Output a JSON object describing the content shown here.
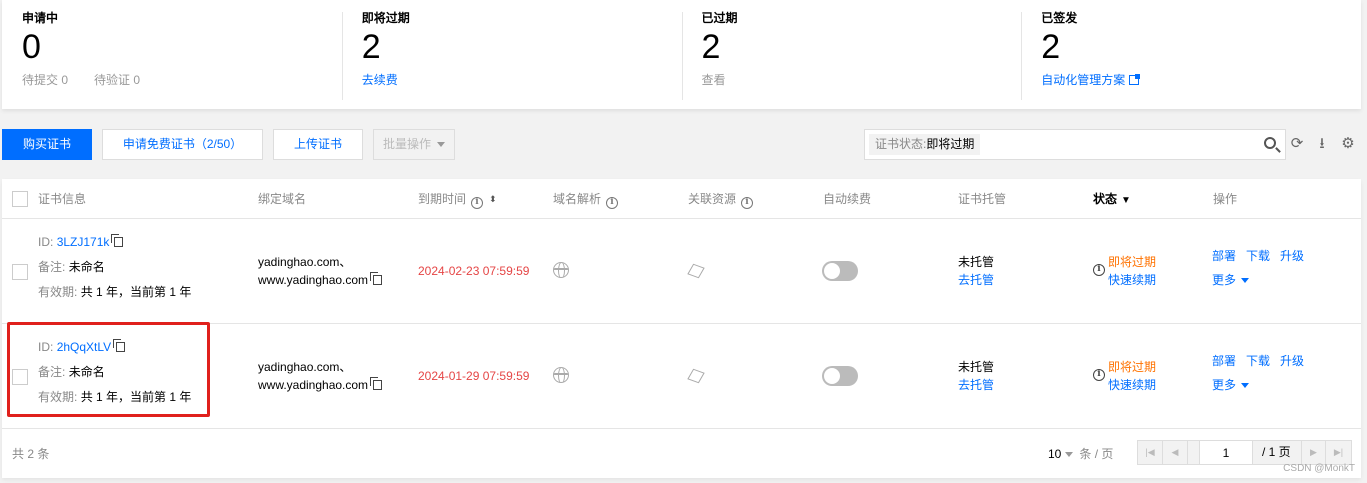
{
  "stats": [
    {
      "title": "申请中",
      "value": "0",
      "subs": [
        "待提交 0",
        "待验证 0"
      ]
    },
    {
      "title": "即将过期",
      "value": "2",
      "link": "去续费"
    },
    {
      "title": "已过期",
      "value": "2",
      "link": "查看"
    },
    {
      "title": "已签发",
      "value": "2",
      "link": "自动化管理方案"
    }
  ],
  "toolbar": {
    "buy": "购买证书",
    "apply_free": "申请免费证书（2/50）",
    "upload": "上传证书",
    "batch": "批量操作",
    "search_tag_key": "证书状态:",
    "search_tag_value": "即将过期"
  },
  "table": {
    "headers": {
      "cert_info": "证书信息",
      "domain": "绑定域名",
      "expire": "到期时间",
      "dns": "域名解析",
      "resources": "关联资源",
      "auto_renew": "自动续费",
      "hosting": "证书托管",
      "status": "状态",
      "actions": "操作"
    },
    "labels": {
      "id": "ID:",
      "note": "备注:",
      "validity": "有效期:"
    },
    "rows": [
      {
        "id": "3LZJ171k",
        "note": "未命名",
        "validity": "共 1 年，当前第 1 年",
        "domain1": "yadinghao.com、",
        "domain2": "www.yadinghao.com",
        "expire": "2024-02-23 07:59:59",
        "hosting": "未托管",
        "hosting_link": "去托管",
        "status": "即将过期",
        "status_link": "快速续期",
        "act_deploy": "部署",
        "act_download": "下载",
        "act_upgrade": "升级",
        "act_more": "更多"
      },
      {
        "id": "2hQqXtLV",
        "note": "未命名",
        "validity": "共 1 年，当前第 1 年",
        "domain1": "yadinghao.com、",
        "domain2": "www.yadinghao.com",
        "expire": "2024-01-29 07:59:59",
        "hosting": "未托管",
        "hosting_link": "去托管",
        "status": "即将过期",
        "status_link": "快速续期",
        "act_deploy": "部署",
        "act_download": "下载",
        "act_upgrade": "升级",
        "act_more": "更多"
      }
    ],
    "footer": {
      "total": "共 2 条",
      "page_size": "10",
      "page_size_unit": "条 / 页",
      "page": "1",
      "page_total": "/ 1 页"
    }
  },
  "watermark": "CSDN @MonkT",
  "colors": {
    "accent": "#006eff",
    "danger": "#e54545",
    "warning": "#ff7200",
    "highlight": "#e0201c"
  }
}
